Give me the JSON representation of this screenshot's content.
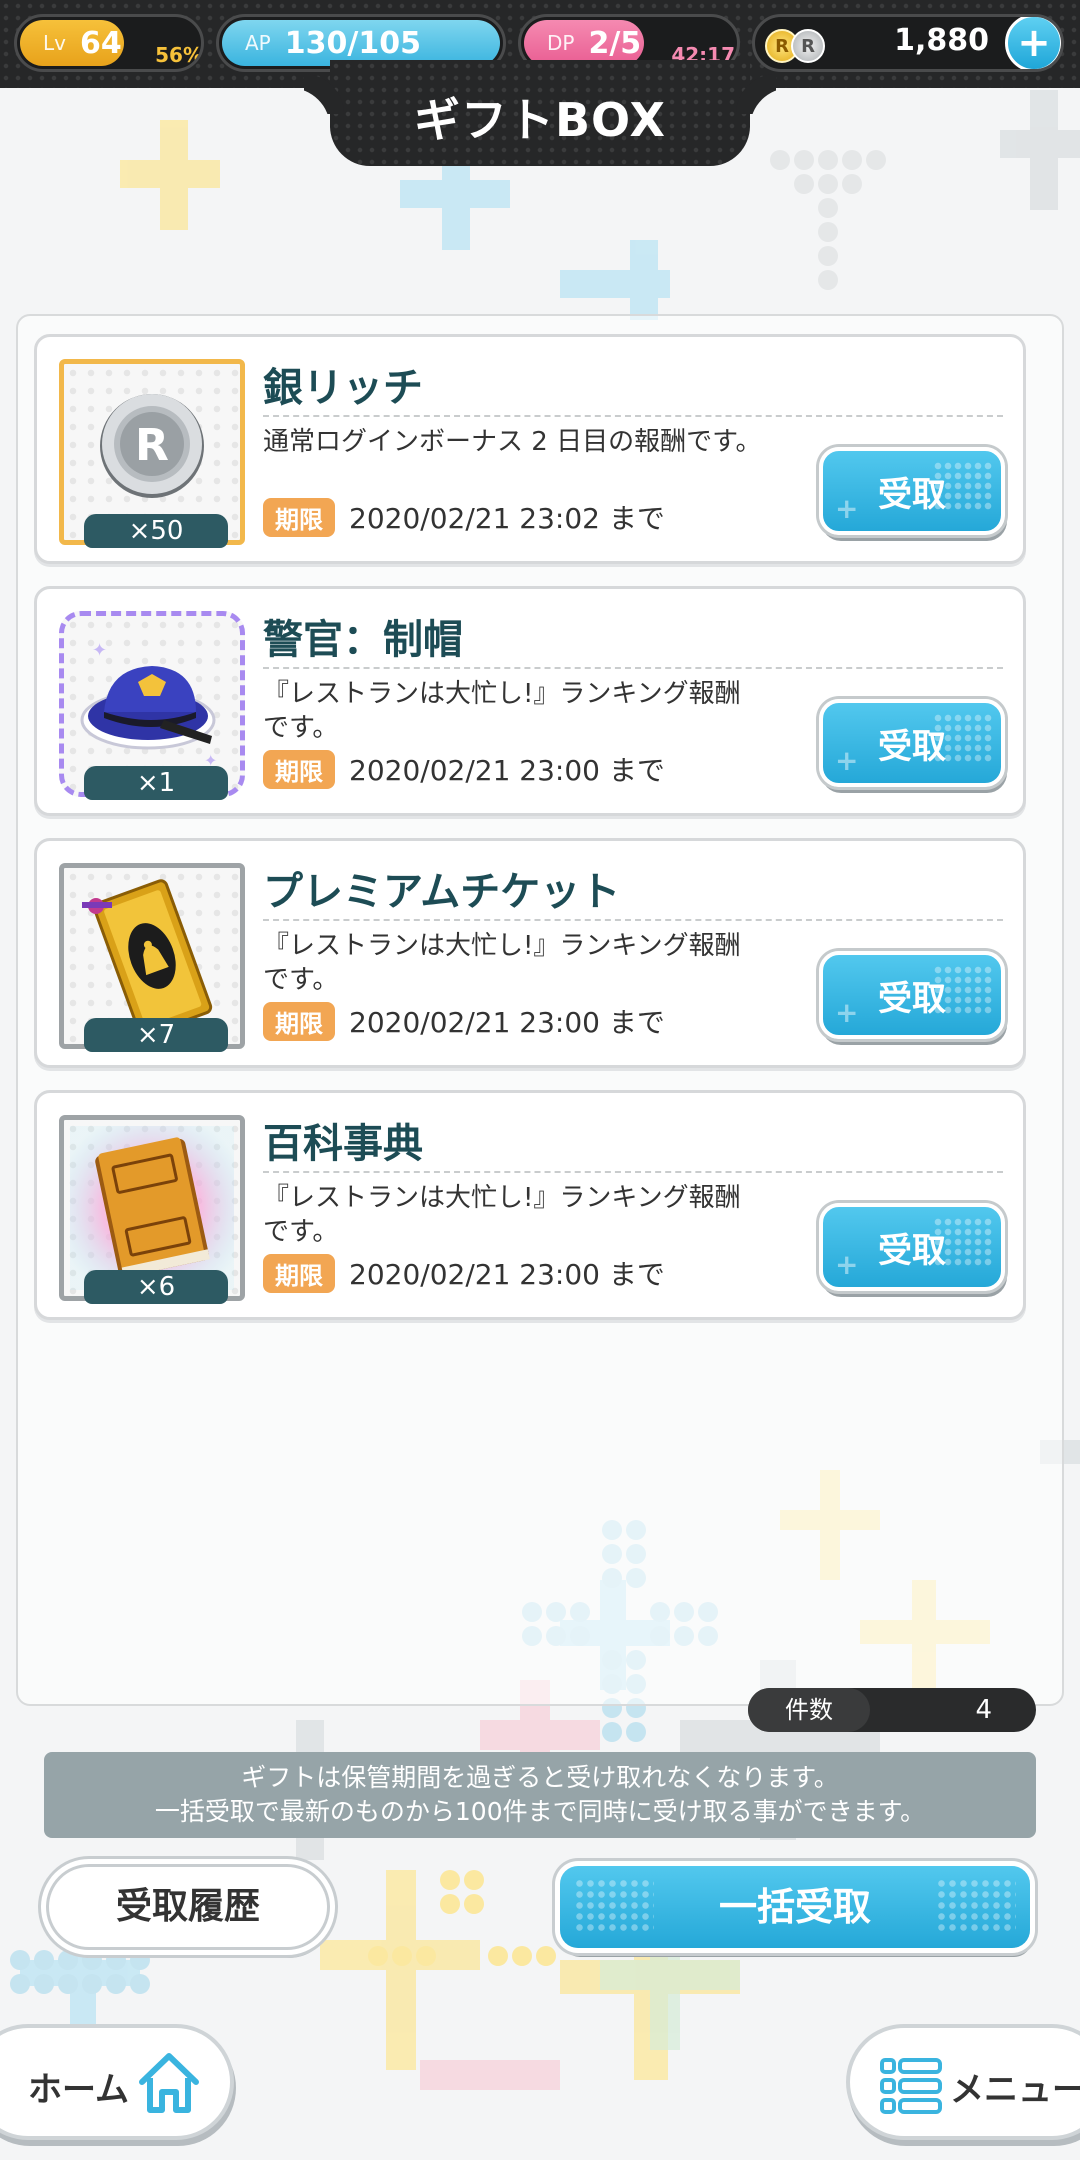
{
  "header": {
    "title": "ギフトBOX",
    "level": {
      "label": "Lv",
      "value": "64",
      "progress": "56%"
    },
    "ap": {
      "label": "AP",
      "value": "130/105"
    },
    "dp": {
      "label": "DP",
      "value": "2/5",
      "timer": "42:17"
    },
    "currency": {
      "value": "1,880",
      "coin_gold": "R",
      "coin_silver": "R",
      "add_icon": "plus-icon"
    }
  },
  "gifts": [
    {
      "name": "銀リッチ",
      "description": "通常ログインボーナス 2 日目の報酬です。",
      "quantity": "×50",
      "limit_label": "期限",
      "limit_date": "2020/02/21 23:02 まで",
      "button": "受取",
      "icon": "silver-coin-icon"
    },
    {
      "name": "警官：制帽",
      "description": "『レストランは大忙し!』ランキング報酬です。",
      "quantity": "×1",
      "limit_label": "期限",
      "limit_date": "2020/02/21 23:00 まで",
      "button": "受取",
      "icon": "police-cap-icon"
    },
    {
      "name": "プレミアムチケット",
      "description": "『レストランは大忙し!』ランキング報酬です。",
      "quantity": "×7",
      "limit_label": "期限",
      "limit_date": "2020/02/21 23:00 まで",
      "button": "受取",
      "icon": "premium-ticket-icon"
    },
    {
      "name": "百科事典",
      "description": "『レストランは大忙し!』ランキング報酬です。",
      "quantity": "×6",
      "limit_label": "期限",
      "limit_date": "2020/02/21 23:00 まで",
      "button": "受取",
      "icon": "encyclopedia-icon"
    }
  ],
  "count": {
    "label": "件数",
    "value": "4"
  },
  "notice": {
    "line1": "ギフトは保管期間を過ぎると受け取れなくなります。",
    "line2": "一括受取で最新のものから100件まで同時に受け取る事ができます。"
  },
  "actions": {
    "history": "受取履歴",
    "bulk_receive": "一括受取"
  },
  "nav": {
    "home": "ホーム",
    "menu": "メニュー",
    "home_icon": "home-icon",
    "menu_icon": "menu-list-icon"
  },
  "colors": {
    "accent_blue": "#25a8d8",
    "level_gold": "#e8a21b",
    "dp_pink": "#e95d92",
    "limit_orange": "#f2a653",
    "title_teal": "#1d4c55"
  }
}
